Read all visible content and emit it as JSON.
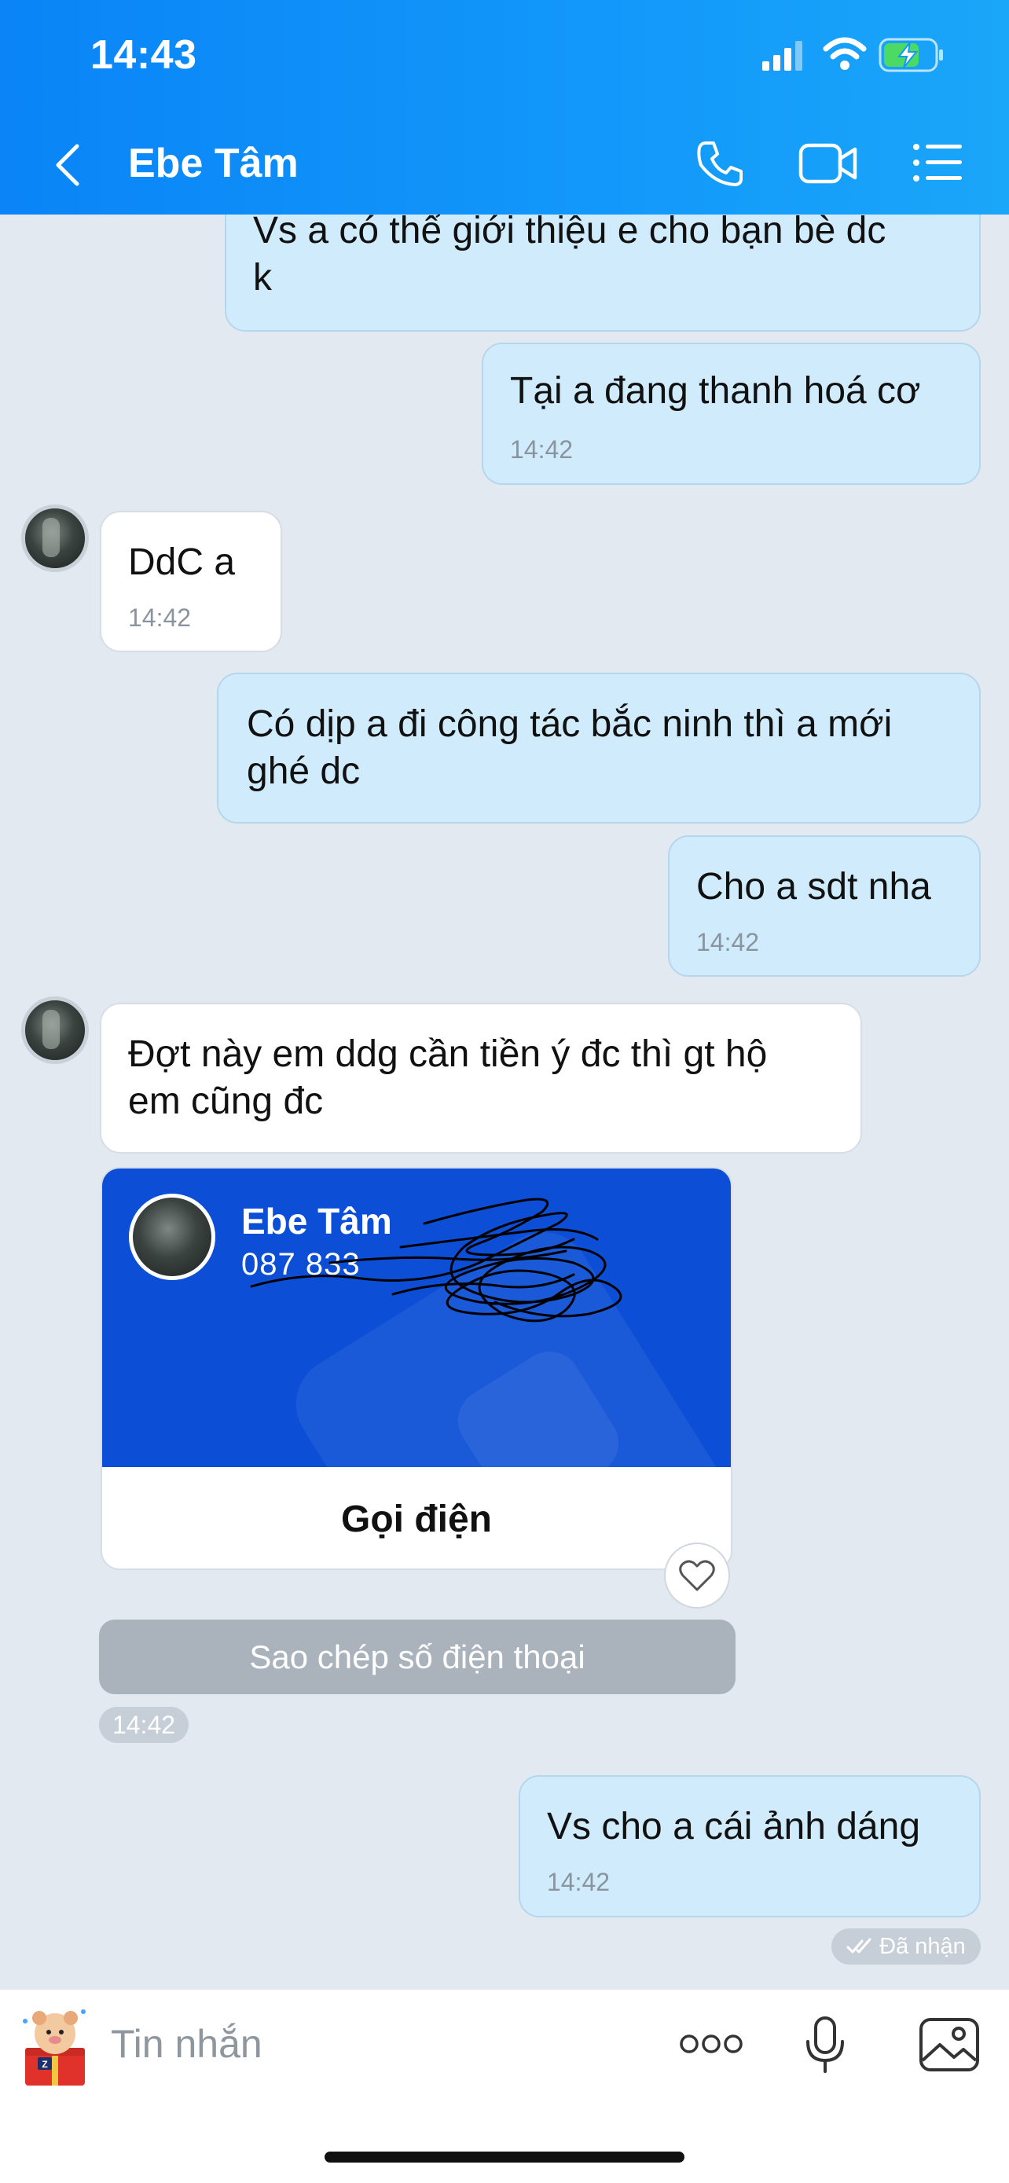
{
  "status_bar": {
    "time": "14:43"
  },
  "header": {
    "title": "Ebe Tâm"
  },
  "messages": [
    {
      "text_line1": "Vs a có thể giới thiệu e cho bạn bè dc",
      "text_line2": "k"
    },
    {
      "text": "Tại a đang thanh hoá cơ",
      "time": "14:42"
    },
    {
      "text": "DdC a",
      "time": "14:42"
    },
    {
      "text_line1": "Có dịp a đi công tác bắc ninh thì a mới",
      "text_line2": "ghé dc"
    },
    {
      "text": "Cho a sdt nha",
      "time": "14:42"
    },
    {
      "text_line1": "Đợt này em ddg cần tiền ý đc thì gt hộ",
      "text_line2": "em cũng đc"
    },
    {
      "text": "Vs cho a cái ảnh dáng",
      "time": "14:42"
    }
  ],
  "contact_card": {
    "name": "Ebe Tâm",
    "phone": "087 833",
    "call_label": "Gọi điện",
    "copy_label": "Sao chép số điện thoại",
    "time": "14:42"
  },
  "receipt": {
    "label": "Đã nhận"
  },
  "composer": {
    "placeholder": "Tin nhắn"
  },
  "icons": {
    "back": "chevron-left-icon",
    "phone": "phone-icon",
    "video": "video-camera-icon",
    "menu": "list-menu-icon",
    "sticker": "sticker-icon",
    "more": "more-dots-icon",
    "mic": "microphone-icon",
    "image": "image-icon",
    "heart": "heart-icon"
  }
}
